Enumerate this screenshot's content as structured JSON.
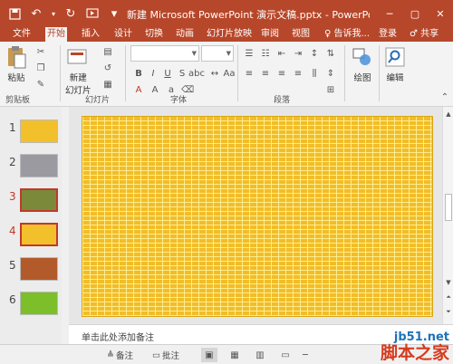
{
  "titlebar": {
    "title": "新建 Microsoft PowerPoint 演示文稿.pptx - PowerPoint(...",
    "minimize_glyph": "─",
    "restore_glyph": "▢",
    "close_glyph": "✕"
  },
  "tabs": [
    {
      "label": "文件"
    },
    {
      "label": "开始",
      "active": true
    },
    {
      "label": "插入"
    },
    {
      "label": "设计"
    },
    {
      "label": "切换"
    },
    {
      "label": "动画"
    },
    {
      "label": "幻灯片放映"
    },
    {
      "label": "审阅"
    },
    {
      "label": "视图"
    },
    {
      "label": "♀ 告诉我..."
    },
    {
      "label": "登录"
    },
    {
      "label": "♂ 共享"
    }
  ],
  "ribbon": {
    "paste_label": "粘贴",
    "clipboard_label": "剪贴板",
    "new_slide_label_1": "新建",
    "new_slide_label_2": "幻灯片",
    "slides_group_label": "幻灯片",
    "font_group_label": "字体",
    "paragraph_group_label": "段落",
    "drawing_label": "绘图",
    "editing_label": "编辑"
  },
  "thumbnails": [
    {
      "num": "1",
      "color": "#f2c02a",
      "selected": false
    },
    {
      "num": "2",
      "color": "#9a9aa0",
      "selected": false
    },
    {
      "num": "3",
      "color": "#7a8a3a",
      "selected": true
    },
    {
      "num": "4",
      "color": "#f2c02a",
      "selected": true
    },
    {
      "num": "5",
      "color": "#b35a2a",
      "selected": false
    },
    {
      "num": "6",
      "color": "#7cbf2a",
      "selected": false
    }
  ],
  "notes": {
    "placeholder": "单击此处添加备注"
  },
  "statusbar": {
    "notes_label": "备注",
    "comments_label": "批注",
    "zoom_minus": "─"
  },
  "watermark": {
    "site": "jb51.net",
    "cn": "脚本之家"
  },
  "colors": {
    "accent": "#b7472a",
    "slide_fill": "#f2bd28"
  }
}
